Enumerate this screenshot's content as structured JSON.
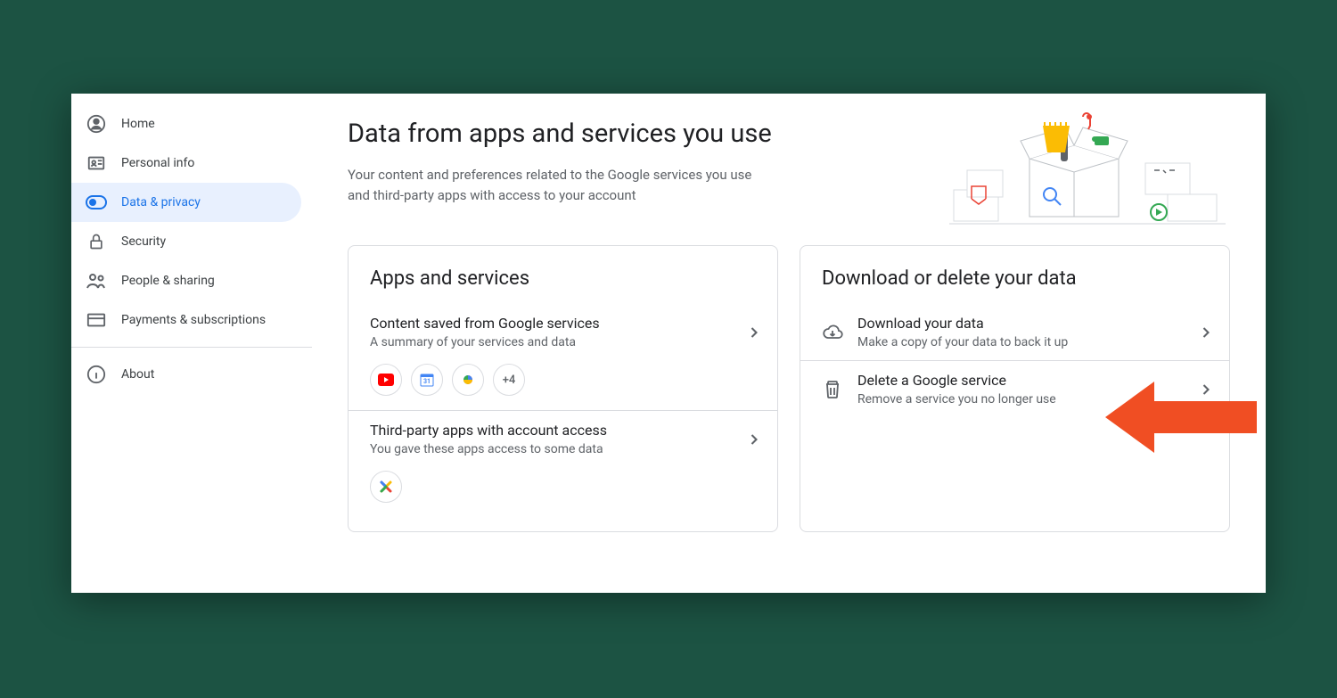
{
  "sidebar": {
    "items": [
      {
        "label": "Home",
        "icon": "account-circle-icon",
        "active": false
      },
      {
        "label": "Personal info",
        "icon": "id-card-icon",
        "active": false
      },
      {
        "label": "Data & privacy",
        "icon": "privacy-toggle-icon",
        "active": true
      },
      {
        "label": "Security",
        "icon": "lock-icon",
        "active": false
      },
      {
        "label": "People & sharing",
        "icon": "people-icon",
        "active": false
      },
      {
        "label": "Payments & subscriptions",
        "icon": "credit-card-icon",
        "active": false
      },
      {
        "label": "About",
        "icon": "info-icon",
        "active": false
      }
    ]
  },
  "main": {
    "title": "Data from apps and services you use",
    "subtitle": "Your content and preferences related to the Google services you use and third-party apps with access to your account"
  },
  "cards": {
    "apps": {
      "title": "Apps and services",
      "content_row": {
        "title": "Content saved from Google services",
        "subtitle": "A summary of your services and data",
        "chips": [
          "youtube-icon",
          "calendar-icon",
          "photos-icon"
        ],
        "more_label": "+4"
      },
      "third_party_row": {
        "title": "Third-party apps with account access",
        "subtitle": "You gave these apps access to some data",
        "chips": [
          "x-app-icon"
        ]
      }
    },
    "download": {
      "title": "Download or delete your data",
      "download_row": {
        "title": "Download your data",
        "subtitle": "Make a copy of your data to back it up"
      },
      "delete_row": {
        "title": "Delete a Google service",
        "subtitle": "Remove a service you no longer use"
      }
    }
  }
}
